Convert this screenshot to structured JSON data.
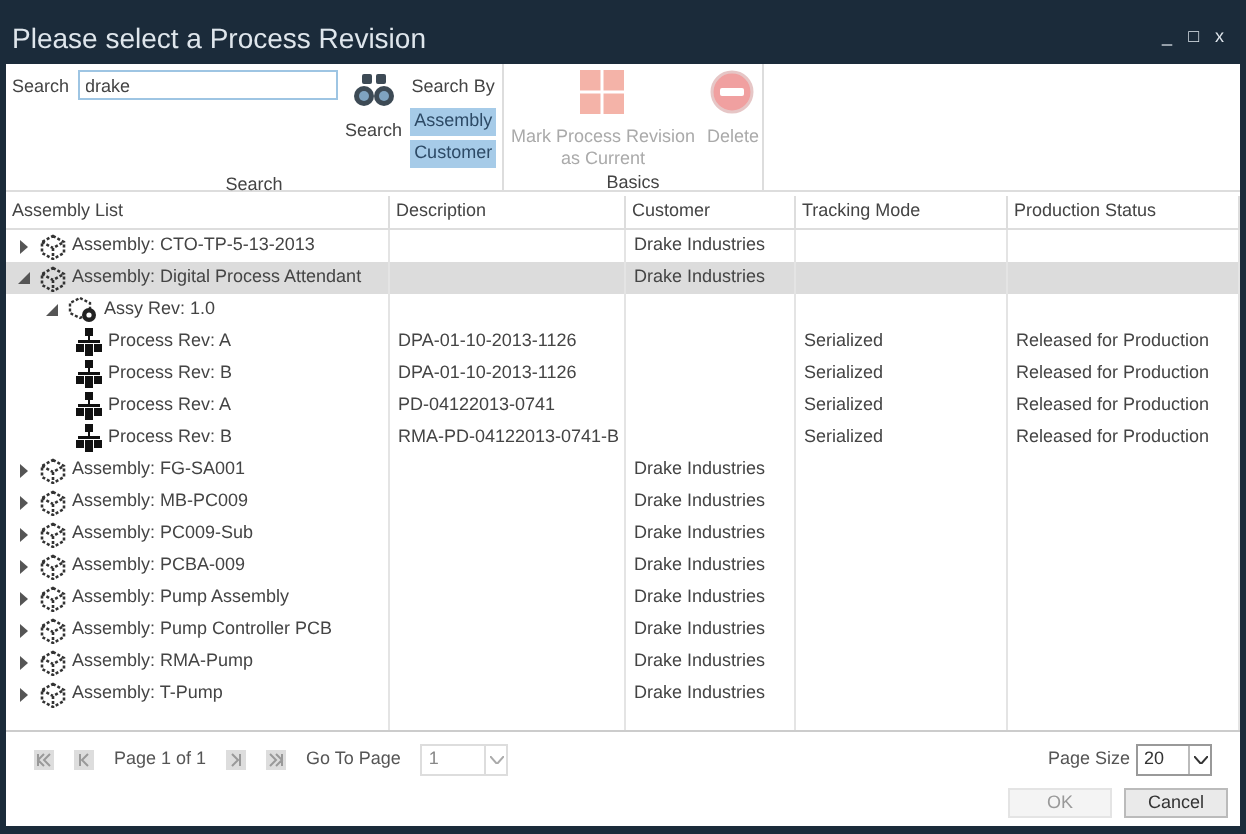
{
  "window": {
    "title": "Please select a Process Revision",
    "controls": [
      "_",
      "□",
      "x"
    ]
  },
  "ribbon": {
    "search_label": "Search",
    "search": {
      "value": "drake"
    },
    "search_button": "Search",
    "search_by_label": "Search By",
    "search_by": [
      {
        "label": "Assembly",
        "on": true
      },
      {
        "label": "Customer",
        "on": true
      }
    ],
    "search_group": "Search",
    "basics": [
      {
        "label": "Mark Process Revision as Current",
        "kind": "grid",
        "disabled": true
      },
      {
        "label": "Delete",
        "kind": "delete",
        "disabled": true
      }
    ],
    "basics_group": "Basics"
  },
  "table": {
    "columns": [
      "Assembly List",
      "Description",
      "Customer",
      "Tracking Mode",
      "Production Status"
    ],
    "rows": [
      {
        "kind": "assembly",
        "name": "Assembly: CTO-TP-5-13-2013",
        "customer": "Drake Industries",
        "expanded": false,
        "selected": false
      },
      {
        "kind": "assembly",
        "name": "Assembly: Digital Process Attendant",
        "customer": "Drake Industries",
        "expanded": true,
        "selected": true,
        "children": [
          {
            "kind": "assy_rev",
            "name": "Assy Rev: 1.0",
            "expanded": true,
            "selected": false,
            "children": [
              {
                "kind": "process_rev",
                "name": "Process Rev: A",
                "description": "DPA-01-10-2013-1126",
                "tracking_mode": "Serialized",
                "production_status": "Released for Production",
                "selected": false
              },
              {
                "kind": "process_rev",
                "name": "Process Rev: B",
                "description": "DPA-01-10-2013-1126",
                "tracking_mode": "Serialized",
                "production_status": "Released for Production",
                "selected": false
              },
              {
                "kind": "process_rev",
                "name": "Process Rev: A",
                "description": "PD-04122013-0741",
                "tracking_mode": "Serialized",
                "production_status": "Released for Production",
                "selected": false
              },
              {
                "kind": "process_rev",
                "name": "Process Rev: B",
                "description": "RMA-PD-04122013-0741-B",
                "tracking_mode": "Serialized",
                "production_status": "Released for Production",
                "selected": false
              }
            ]
          }
        ]
      },
      {
        "kind": "assembly",
        "name": "Assembly: FG-SA001",
        "customer": "Drake Industries",
        "expanded": false,
        "selected": false
      },
      {
        "kind": "assembly",
        "name": "Assembly: MB-PC009",
        "customer": "Drake Industries",
        "expanded": false,
        "selected": false
      },
      {
        "kind": "assembly",
        "name": "Assembly: PC009-Sub",
        "customer": "Drake Industries",
        "expanded": false,
        "selected": false
      },
      {
        "kind": "assembly",
        "name": "Assembly: PCBA-009",
        "customer": "Drake Industries",
        "expanded": false,
        "selected": false
      },
      {
        "kind": "assembly",
        "name": "Assembly: Pump Assembly",
        "customer": "Drake Industries",
        "expanded": false,
        "selected": false
      },
      {
        "kind": "assembly",
        "name": "Assembly: Pump Controller PCB",
        "customer": "Drake Industries",
        "expanded": false,
        "selected": false
      },
      {
        "kind": "assembly",
        "name": "Assembly: RMA-Pump",
        "customer": "Drake Industries",
        "expanded": false,
        "selected": false
      },
      {
        "kind": "assembly",
        "name": "Assembly: T-Pump",
        "customer": "Drake Industries",
        "expanded": false,
        "selected": false
      }
    ]
  },
  "pager": {
    "page_info": "Page 1 of 1",
    "go_to_label": "Go To Page",
    "go_to": {
      "value": "1",
      "disabled": true
    },
    "page_size_label": "Page Size",
    "page_size": {
      "value": "20"
    }
  },
  "buttons": [
    {
      "label": "OK",
      "disabled": true
    },
    {
      "label": "Cancel",
      "disabled": false
    }
  ]
}
